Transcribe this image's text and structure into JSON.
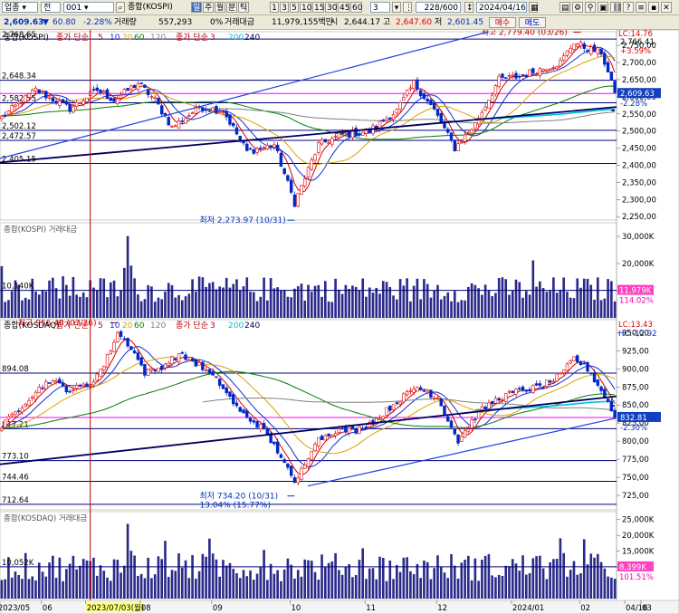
{
  "toolbar": {
    "market": "업종",
    "scope": "전",
    "code": "001",
    "name": "종합(KOSPI)",
    "periods": [
      "일",
      "주",
      "월",
      "분",
      "틱"
    ],
    "active_period": "일",
    "minute_opts": [
      "1",
      "3",
      "5",
      "10",
      "15",
      "30",
      "45",
      "60"
    ],
    "mult": "3",
    "page": "228/600",
    "date": "2024/04/16",
    "buy": "매수",
    "sell": "매도"
  },
  "quote": {
    "price": "2,609.63",
    "arrow": "▼",
    "change": "60.80",
    "change_pct": "-2.28%",
    "vol_label": "거래량",
    "volume": "557,293",
    "ratio": "0%",
    "amt_label": "거래대금",
    "amount": "11,979,155백만",
    "open_label": "시",
    "open": "2,644.17",
    "high_label": "고",
    "high": "2,647.60",
    "low_label": "저",
    "low": "2,601.45"
  },
  "colors": {
    "up": "#e00000",
    "down": "#0028c8",
    "ma5": "#d00000",
    "ma10": "#1030d0",
    "ma20": "#e0a000",
    "ma60": "#008000",
    "ma120": "#808080",
    "ma200": "#00c0e0",
    "ma240": "#000050",
    "hline": "#000080",
    "pink": "#ff00ff"
  },
  "chart_data": [
    {
      "type": "candlestick",
      "panel": "KOSPI",
      "legend": [
        "종합(KOSPI)",
        "종가 단순",
        "5",
        "10",
        "20",
        "60",
        "120",
        "종가 단순",
        "3",
        "200",
        "240"
      ],
      "top_label": "LC:14.76",
      "ylim": [
        2240,
        2790
      ],
      "ytick_labels": [
        "2,750,00",
        "2,700,00",
        "2,650,00",
        "2,600,00",
        "2,550,00",
        "2,500,00",
        "2,450,00",
        "2,400,00",
        "2,350,00",
        "2,300,00",
        "2,250,00"
      ],
      "yticks": [
        2750,
        2700,
        2650,
        2600,
        2550,
        2500,
        2450,
        2400,
        2350,
        2300,
        2250
      ],
      "hlines": [
        {
          "label": "2,768.65",
          "value": 2768.65
        },
        {
          "label": "2,648.34",
          "value": 2648.34
        },
        {
          "label": "2,582.55",
          "value": 2582.55
        },
        {
          "label": "2,502.12",
          "value": 2502.12
        },
        {
          "label": "2,472.57",
          "value": 2472.57
        },
        {
          "label": "2,405.15",
          "value": 2405.15
        }
      ],
      "pink_line": 2609.63,
      "right_labels": {
        "high": "2,766.41",
        "high_pct": "+3.59%",
        "price": "2,609.63",
        "price_pct": "-2.28%"
      },
      "annot_high": "최고 2,779.40 (03/26)",
      "annot_low": "최저 2,273.97 (10/31)",
      "anchors": [
        {
          "i": 0,
          "v": 2540
        },
        {
          "i": 10,
          "v": 2620
        },
        {
          "i": 20,
          "v": 2565
        },
        {
          "i": 28,
          "v": 2620
        },
        {
          "i": 33,
          "v": 2590
        },
        {
          "i": 40,
          "v": 2640
        },
        {
          "i": 45,
          "v": 2590
        },
        {
          "i": 50,
          "v": 2510
        },
        {
          "i": 58,
          "v": 2570
        },
        {
          "i": 65,
          "v": 2560
        },
        {
          "i": 72,
          "v": 2440
        },
        {
          "i": 80,
          "v": 2460
        },
        {
          "i": 86,
          "v": 2290
        },
        {
          "i": 93,
          "v": 2460
        },
        {
          "i": 100,
          "v": 2490
        },
        {
          "i": 108,
          "v": 2500
        },
        {
          "i": 116,
          "v": 2560
        },
        {
          "i": 121,
          "v": 2640
        },
        {
          "i": 127,
          "v": 2560
        },
        {
          "i": 133,
          "v": 2450
        },
        {
          "i": 139,
          "v": 2520
        },
        {
          "i": 146,
          "v": 2650
        },
        {
          "i": 152,
          "v": 2660
        },
        {
          "i": 158,
          "v": 2680
        },
        {
          "i": 164,
          "v": 2700
        },
        {
          "i": 168,
          "v": 2760
        },
        {
          "i": 172,
          "v": 2740
        },
        {
          "i": 176,
          "v": 2730
        },
        {
          "i": 179,
          "v": 2640
        },
        {
          "i": 180,
          "v": 2612
        }
      ]
    },
    {
      "type": "bar",
      "panel": "KOSPI 거래대금",
      "legend": "종합(KOSPI) 거래대금",
      "ylim": [
        0,
        35000
      ],
      "ytick_labels": [
        "30,000K",
        "20,000K",
        "10,000K"
      ],
      "yticks": [
        30000,
        20000,
        10000
      ],
      "hline": {
        "label": "10,140K",
        "value": 10140
      },
      "right_labels": [
        "11,979K",
        "114.02%"
      ],
      "typical": 10500
    },
    {
      "type": "candlestick",
      "panel": "KOSDAQ",
      "legend": [
        "종합(KOSDAQ)",
        "종가 단순",
        "5",
        "10",
        "20",
        "60",
        "120",
        "종가 단순",
        "3",
        "200",
        "240"
      ],
      "top_labels": [
        "LC:13.43",
        "HC:-12.92"
      ],
      "ylim": [
        705,
        968
      ],
      "ytick_labels": [
        "950,00",
        "925,00",
        "900,00",
        "875,00",
        "850,00",
        "825,00",
        "800,00",
        "775,00",
        "750,00",
        "725,00"
      ],
      "yticks": [
        950,
        925,
        900,
        875,
        850,
        825,
        800,
        775,
        750,
        725
      ],
      "hlines": [
        {
          "label": "894.08",
          "value": 894.08
        },
        {
          "label": "817.21",
          "value": 817.21
        },
        {
          "label": "773.10",
          "value": 773.1
        },
        {
          "label": "744.46",
          "value": 744.46
        },
        {
          "label": "712.64",
          "value": 712.64
        }
      ],
      "pink_line": 832.81,
      "right_labels": {
        "price": "832.81",
        "price_pct": "-2.30%"
      },
      "annot_high": "최고 956.40 (07/26)",
      "annot_low": "최저 734.20 (10/31)",
      "annot_low2": "13.04% (15.77%)",
      "anchors": [
        {
          "i": 0,
          "v": 820
        },
        {
          "i": 8,
          "v": 860
        },
        {
          "i": 14,
          "v": 885
        },
        {
          "i": 20,
          "v": 870
        },
        {
          "i": 26,
          "v": 880
        },
        {
          "i": 30,
          "v": 905
        },
        {
          "i": 34,
          "v": 950
        },
        {
          "i": 38,
          "v": 930
        },
        {
          "i": 42,
          "v": 895
        },
        {
          "i": 46,
          "v": 900
        },
        {
          "i": 52,
          "v": 920
        },
        {
          "i": 58,
          "v": 905
        },
        {
          "i": 64,
          "v": 880
        },
        {
          "i": 70,
          "v": 840
        },
        {
          "i": 76,
          "v": 820
        },
        {
          "i": 82,
          "v": 780
        },
        {
          "i": 86,
          "v": 740
        },
        {
          "i": 92,
          "v": 800
        },
        {
          "i": 98,
          "v": 815
        },
        {
          "i": 104,
          "v": 815
        },
        {
          "i": 110,
          "v": 830
        },
        {
          "i": 116,
          "v": 855
        },
        {
          "i": 122,
          "v": 875
        },
        {
          "i": 128,
          "v": 860
        },
        {
          "i": 134,
          "v": 800
        },
        {
          "i": 140,
          "v": 840
        },
        {
          "i": 146,
          "v": 860
        },
        {
          "i": 152,
          "v": 870
        },
        {
          "i": 158,
          "v": 875
        },
        {
          "i": 164,
          "v": 890
        },
        {
          "i": 168,
          "v": 915
        },
        {
          "i": 172,
          "v": 900
        },
        {
          "i": 176,
          "v": 870
        },
        {
          "i": 179,
          "v": 845
        },
        {
          "i": 180,
          "v": 833
        }
      ]
    },
    {
      "type": "bar",
      "panel": "KOSDAQ 거래대금",
      "legend": "종합(KOSDAQ) 거래대금",
      "ylim": [
        0,
        27500
      ],
      "ytick_labels": [
        "25,000K",
        "20,000K",
        "15,000K",
        "10,000K"
      ],
      "yticks": [
        25000,
        20000,
        15000,
        10000
      ],
      "hline": {
        "label": "10,052K",
        "value": 10052
      },
      "right_labels": [
        "8,399K",
        "101.51%"
      ],
      "typical": 10000
    }
  ],
  "x_axis": {
    "labels": [
      "2023/05",
      "06",
      "2023/07/03(월)",
      "08",
      "09",
      "10",
      "11",
      "12",
      "2024/01",
      "02",
      "03",
      "04",
      "04/16"
    ],
    "positions": [
      0,
      13,
      26,
      42,
      63,
      86,
      108,
      129,
      151,
      171,
      189,
      208,
      227
    ]
  }
}
